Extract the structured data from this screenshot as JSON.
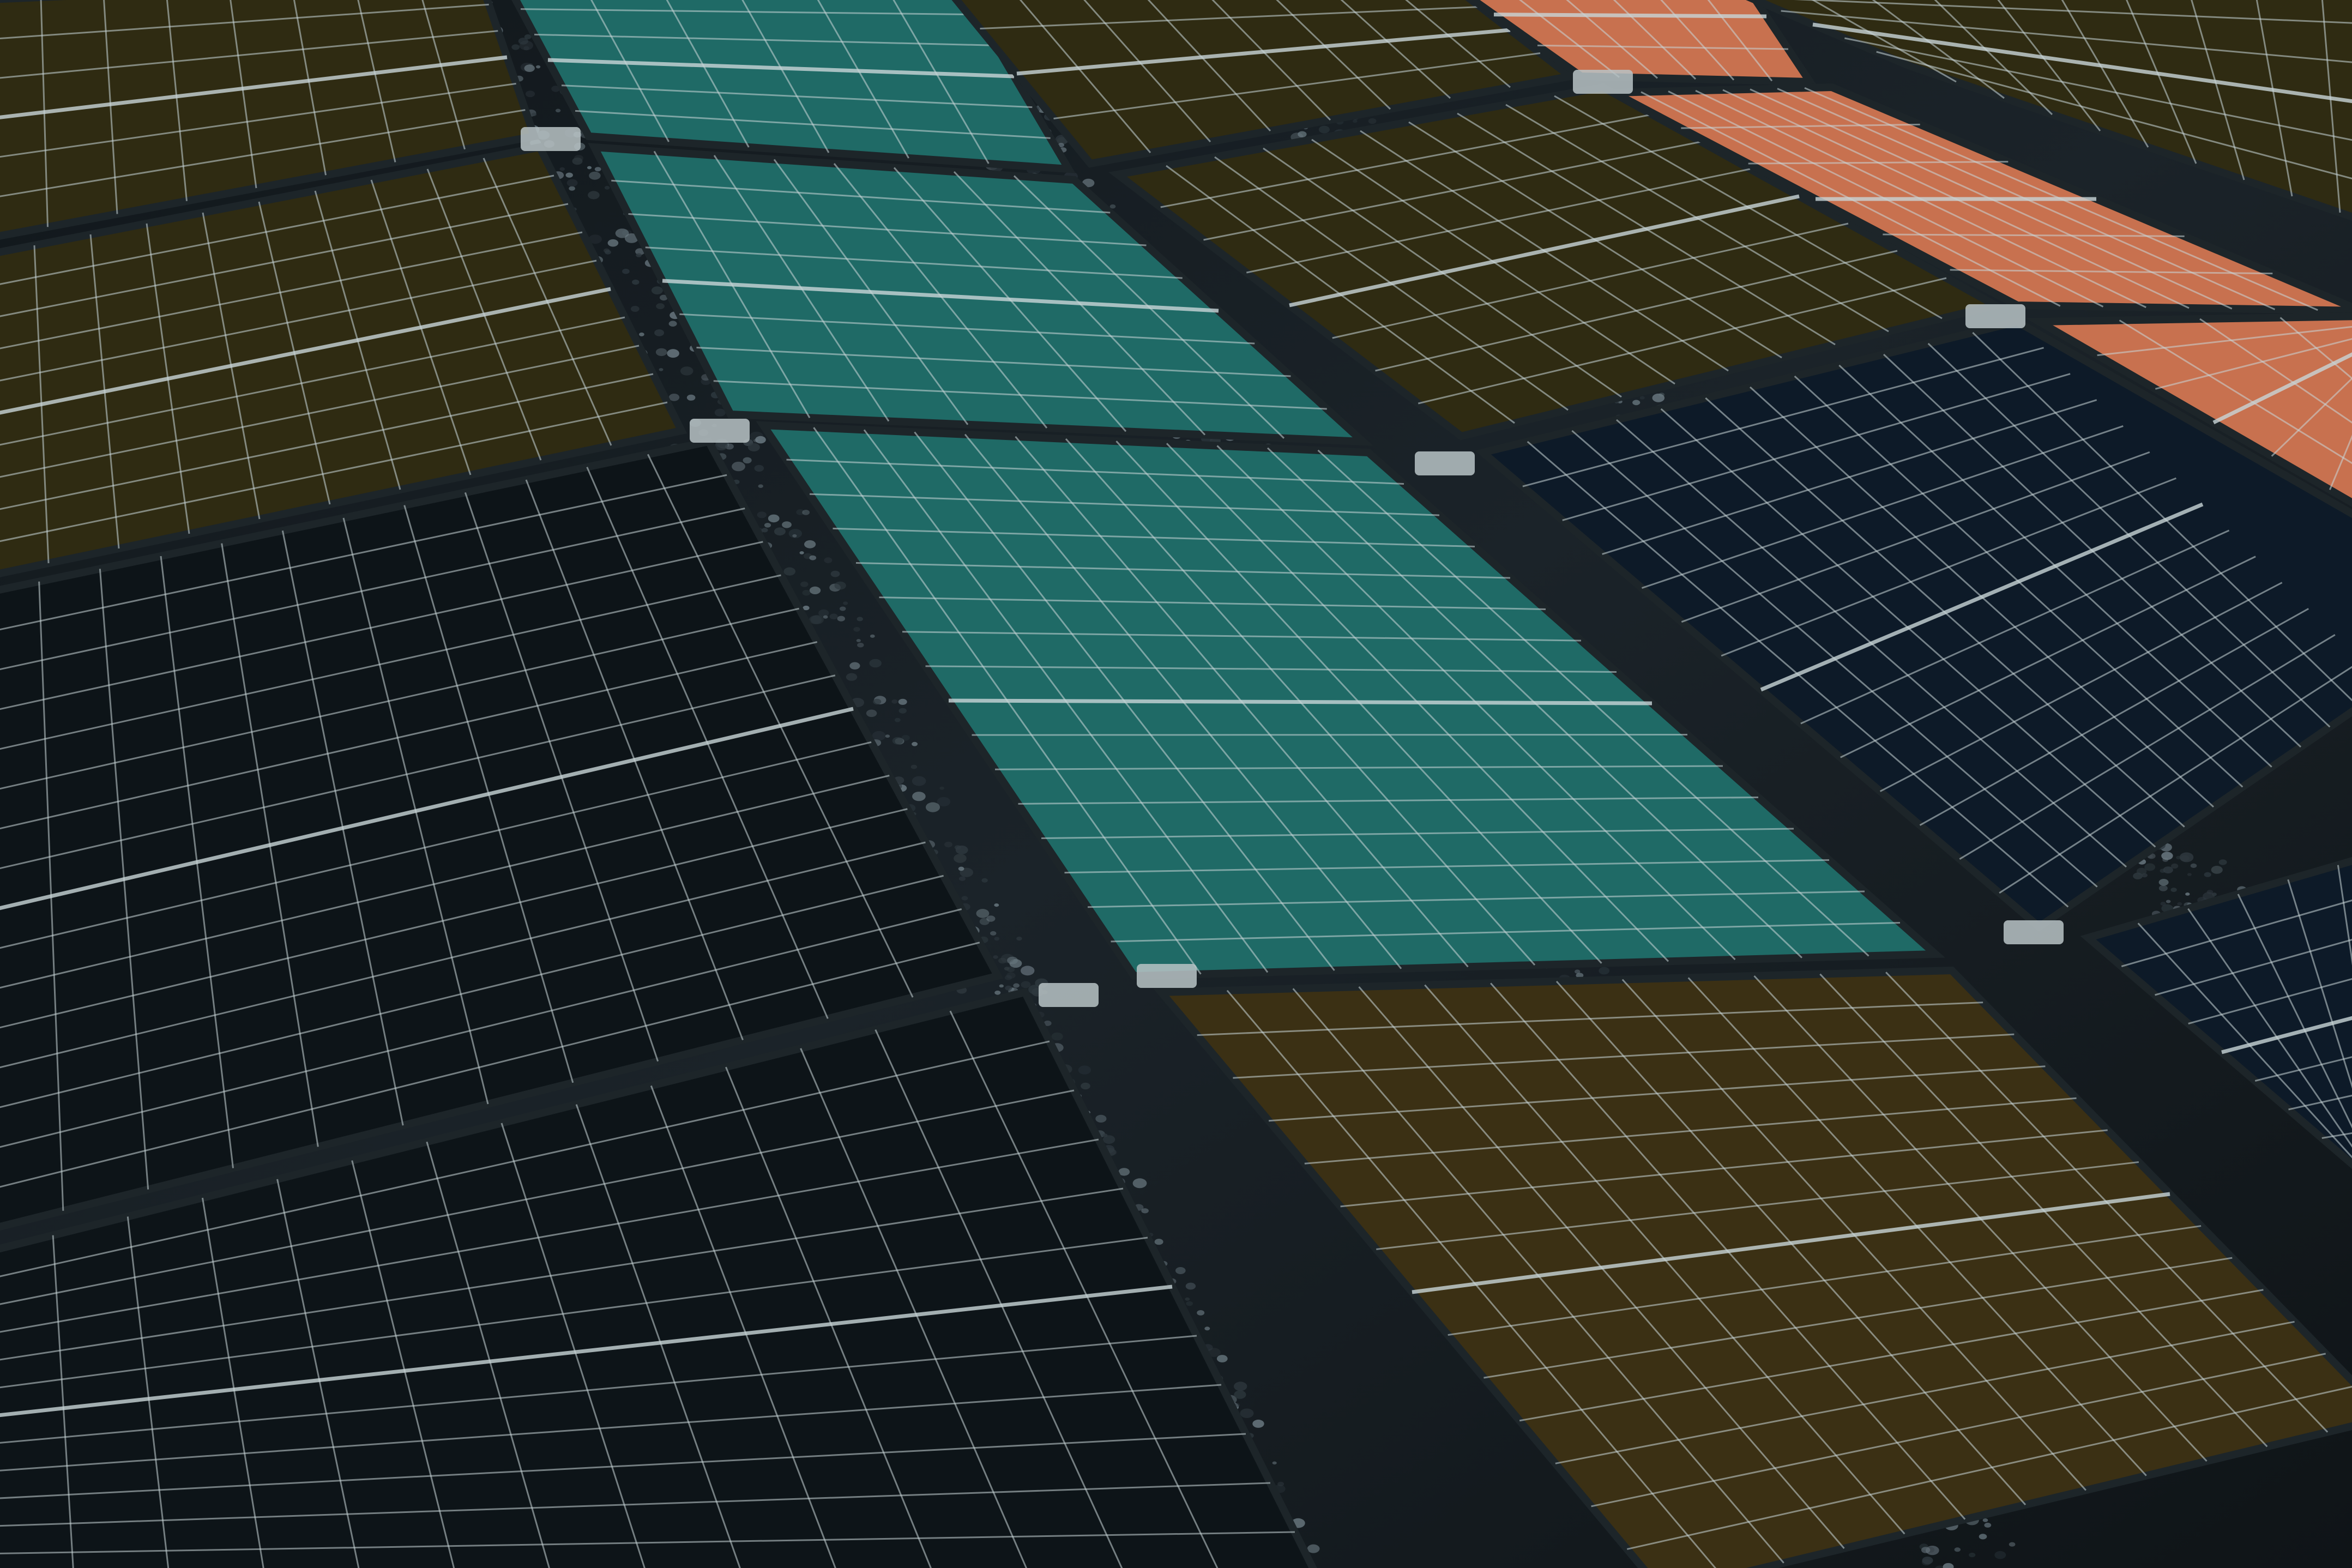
{
  "scene": {
    "subject": "rooftop-solar-array",
    "colors": {
      "background": "#0b0f12",
      "gravel": "#1a2025",
      "gravel_stone_light": "#6b7a82",
      "gravel_stone_dark": "#2e383e",
      "frame": "#1d2529",
      "cell_line": "#c9d6d8",
      "clamp": "#b9c3c6",
      "panel_dark": "#0d1418",
      "panel_olive": "#2f2b12",
      "panel_teal": "#1f6a66",
      "panel_navy": "#0d1a28",
      "panel_peach": "#c8714f",
      "panel_brown": "#3b3014"
    }
  }
}
